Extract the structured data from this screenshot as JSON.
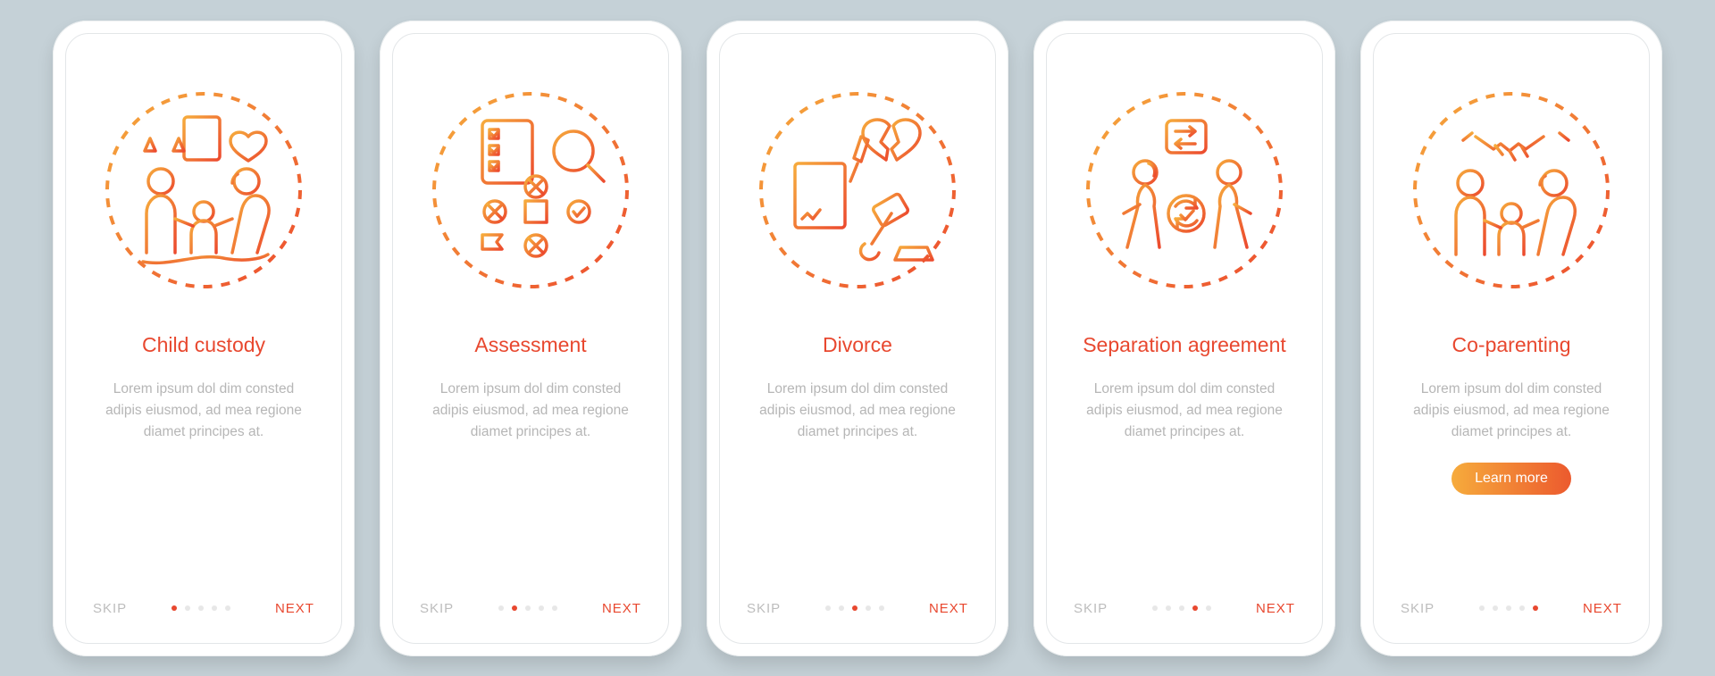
{
  "screens": [
    {
      "title": "Child custody",
      "desc": "Lorem ipsum dol dim consted adipis eiusmod, ad mea regione diamet principes at.",
      "cta": null,
      "active": 0
    },
    {
      "title": "Assessment",
      "desc": "Lorem ipsum dol dim consted adipis eiusmod, ad mea regione diamet principes at.",
      "cta": null,
      "active": 1
    },
    {
      "title": "Divorce",
      "desc": "Lorem ipsum dol dim consted adipis eiusmod, ad mea regione diamet principes at.",
      "cta": null,
      "active": 2
    },
    {
      "title": "Separation agreement",
      "desc": "Lorem ipsum dol dim consted adipis eiusmod, ad mea regione diamet principes at.",
      "cta": null,
      "active": 3
    },
    {
      "title": "Co-parenting",
      "desc": "Lorem ipsum dol dim consted adipis eiusmod, ad mea regione diamet principes at.",
      "cta": "Learn more",
      "active": 4
    }
  ],
  "nav": {
    "skip": "SKIP",
    "next": "NEXT",
    "dotCount": 5
  },
  "colors": {
    "accent": "#e8482f",
    "gray": "#bdbdbd",
    "dotInactive": "#e7e7e7",
    "gradStart": "#f6ab3c",
    "gradEnd": "#ec5a2e"
  }
}
